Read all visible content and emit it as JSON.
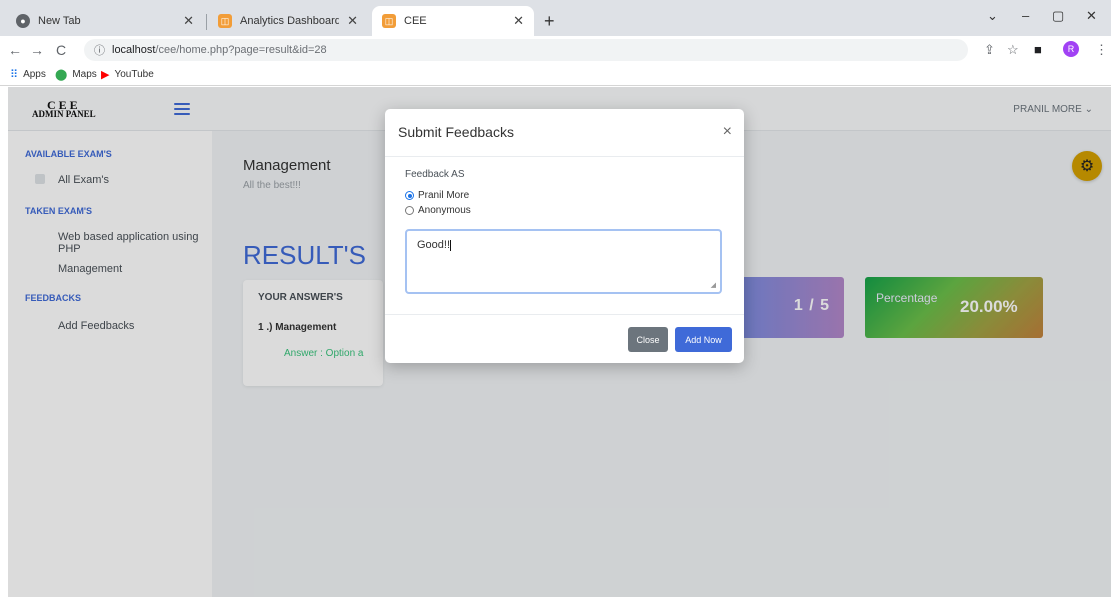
{
  "browser": {
    "tabs": [
      {
        "title": "New Tab",
        "active": false
      },
      {
        "title": "Analytics Dashboard - This is an ·",
        "active": false
      },
      {
        "title": "CEE",
        "active": true
      }
    ],
    "new_tab": "+",
    "url_host": "localhost",
    "url_path": "/cee/home.php?page=result&id=28",
    "bookmarks": [
      "Apps",
      "Maps",
      "YouTube"
    ],
    "profile_initial": "R"
  },
  "app": {
    "logo_line1": "CEE",
    "logo_line2": "ADMIN PANEL",
    "user_name": "PRANIL MORE",
    "sidebar": {
      "sections": [
        {
          "heading": "AVAILABLE EXAM'S",
          "items": [
            "All Exam's"
          ]
        },
        {
          "heading": "TAKEN EXAM'S",
          "items": [
            "Web based application using PHP",
            "Management"
          ]
        },
        {
          "heading": "FEEDBACKS",
          "items": [
            "Add Feedbacks"
          ]
        }
      ]
    },
    "page": {
      "title": "Management",
      "subtitle": "All the best!!!",
      "results_heading": "RESULT'S",
      "answers_heading": "YOUR ANSWER'S",
      "question": "1 .) Management",
      "answer": "Answer : Option a",
      "score": "1 / 5",
      "percentage_label": "Percentage",
      "percentage_value": "20.00%"
    },
    "colors": {
      "accent": "#3f6ad8",
      "settings_button": "#d4a000",
      "answer_text": "#3ac47d"
    }
  },
  "modal": {
    "title": "Submit Feedbacks",
    "close_symbol": "×",
    "feedback_label": "Feedback AS",
    "options": [
      {
        "label": "Pranil More",
        "selected": true
      },
      {
        "label": "Anonymous",
        "selected": false
      }
    ],
    "textarea_value": "Good!!",
    "close_button": "Close",
    "add_button": "Add Now"
  }
}
